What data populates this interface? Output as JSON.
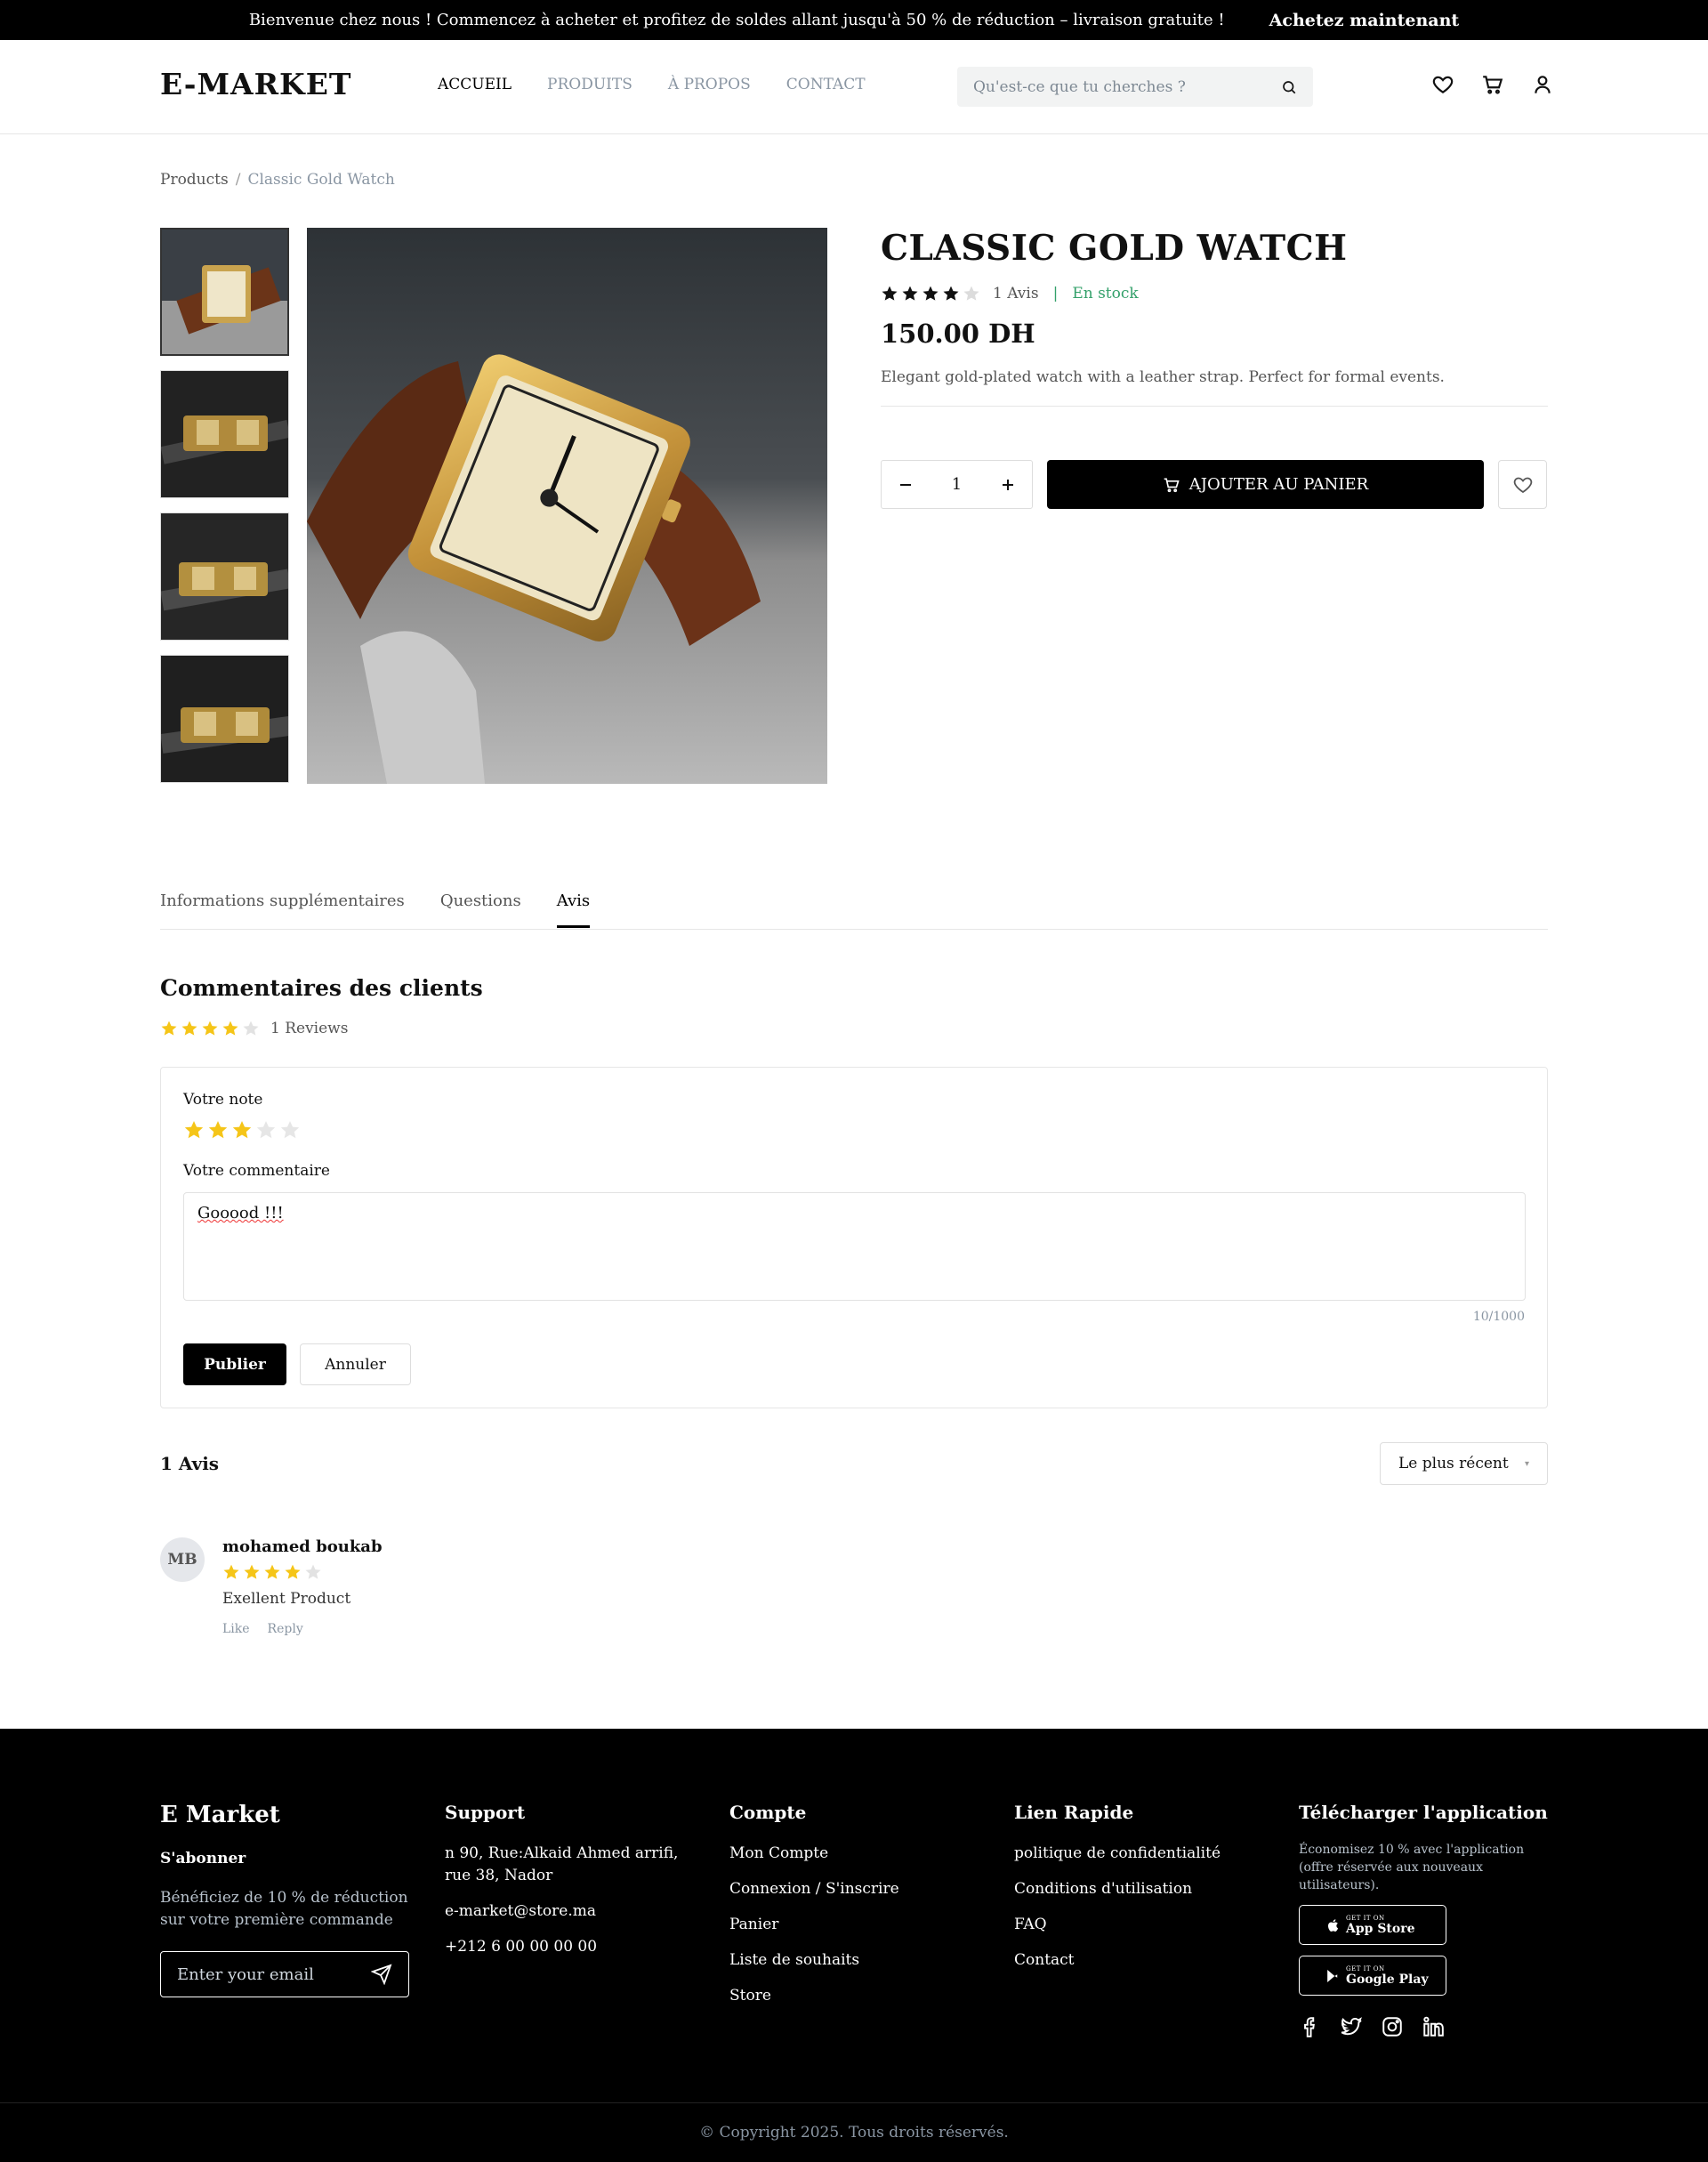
{
  "topbar": {
    "promo": "Bienvenue chez nous ! Commencez à acheter et profitez de soldes allant jusqu'à 50 % de réduction – livraison gratuite !",
    "cta": "Achetez maintenant"
  },
  "header": {
    "logo": "E-MARKET",
    "nav": [
      "ACCUEIL",
      "PRODUITS",
      "À PROPOS",
      "CONTACT"
    ],
    "search_placeholder": "Qu'est-ce que tu cherches ?",
    "icons": [
      "heart-icon",
      "cart-icon",
      "user-icon"
    ]
  },
  "breadcrumb": {
    "root": "Products",
    "separator": "/",
    "current": "Classic Gold Watch"
  },
  "product": {
    "title": "CLASSIC GOLD WATCH",
    "rating": 4,
    "rating_max": 5,
    "reviews_count": "1 Avis",
    "stock": "En stock",
    "price": "150.00 DH",
    "description": "Elegant gold-plated watch with a leather strap. Perfect for formal events.",
    "quantity": "1",
    "add_to_cart": "AJOUTER AU PANIER",
    "thumbnails": 4
  },
  "tabs": [
    "Informations supplémentaires",
    "Questions",
    "Avis"
  ],
  "reviews_section": {
    "title": "Commentaires des clients",
    "summary": "1 Reviews",
    "form": {
      "rating_label": "Votre note",
      "rating_value": 3,
      "comment_label": "Votre commentaire",
      "comment_value": "Gooood !!!",
      "counter": "10/1000",
      "publish": "Publier",
      "cancel": "Annuler"
    },
    "count_label": "1 Avis",
    "sort": "Le plus récent",
    "items": [
      {
        "initials": "MB",
        "name": "mohamed boukab",
        "rating": 4,
        "text": "Exellent Product",
        "like": "Like",
        "reply": "Reply"
      }
    ]
  },
  "footer": {
    "brand": "E Market",
    "subscribe": "S'abonner",
    "subscribe_note": "Bénéficiez de 10 % de réduction sur votre première commande",
    "email_placeholder": "Enter your email",
    "support": {
      "title": "Support",
      "address": "n 90, Rue:Alkaid Ahmed arrifi, rue 38, Nador",
      "email": "e-market@store.ma",
      "phone": "+212 6 00 00 00 00"
    },
    "account": {
      "title": "Compte",
      "links": [
        "Mon Compte",
        "Connexion / S'inscrire",
        "Panier",
        "Liste de souhaits",
        "Store"
      ]
    },
    "quick": {
      "title": "Lien Rapide",
      "links": [
        "politique de confidentialité",
        "Conditions d'utilisation",
        "FAQ",
        "Contact"
      ]
    },
    "app": {
      "title": "Télécharger l'application",
      "note": "Économisez 10 % avec l'application (offre réservée aux nouveaux utilisateurs).",
      "appstore_small": "GET IT ON",
      "appstore": "App Store",
      "googleplay_small": "GET IT ON",
      "googleplay": "Google Play"
    },
    "socials": [
      "facebook-icon",
      "twitter-icon",
      "instagram-icon",
      "linkedin-icon"
    ],
    "copyright": "© Copyright 2025. Tous droits réservés."
  },
  "colors": {
    "accent": "#000000",
    "stock": "#33a06a",
    "star": "#f5c518",
    "muted": "#8a96a3"
  }
}
